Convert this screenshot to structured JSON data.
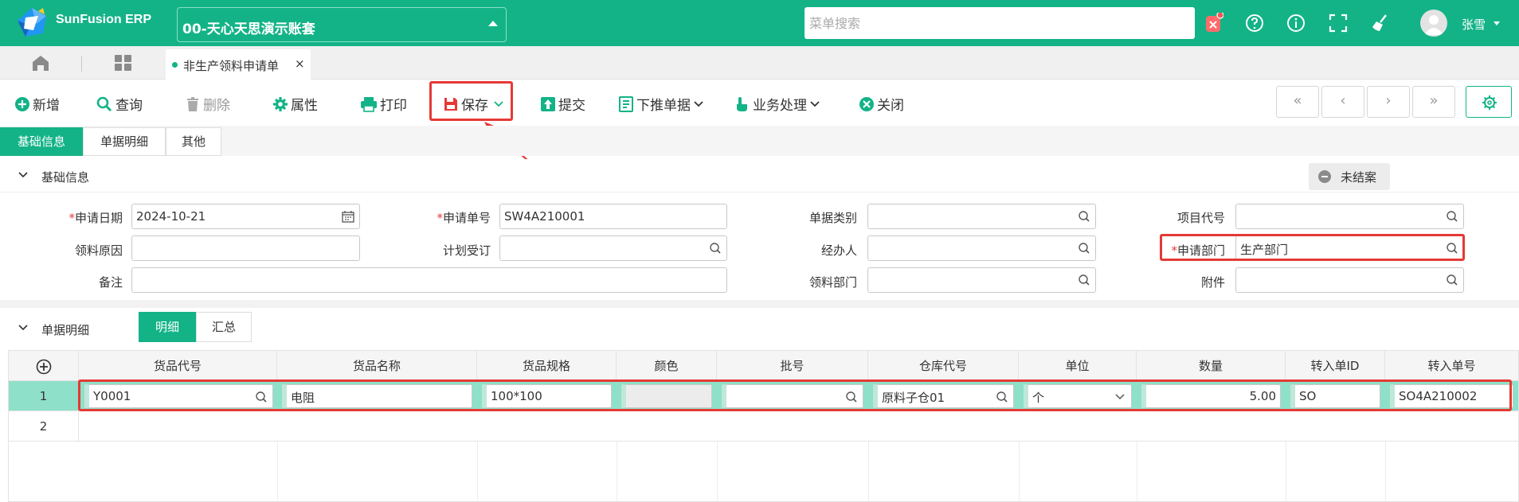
{
  "app": {
    "brand": "SunFusion ERP",
    "account": "00-天心天思演示账套",
    "search_placeholder": "菜单搜索",
    "user": "张雪"
  },
  "colors": {
    "primary": "#13b387",
    "highlight": "#e53935"
  },
  "tabs": {
    "doc_tab": "非生产领料申请单",
    "close": "×"
  },
  "toolbar": {
    "new": "新增",
    "query": "查询",
    "delete": "删除",
    "props": "属性",
    "print": "打印",
    "save": "保存",
    "submit": "提交",
    "push_down": "下推单据",
    "business": "业务处理",
    "close": "关闭",
    "nav": [
      "«",
      "‹",
      "›",
      "»"
    ]
  },
  "section_tabs": [
    "基础信息",
    "单据明细",
    "其他"
  ],
  "basic": {
    "title": "基础信息",
    "status": "未结案",
    "fields": {
      "apply_date_label": "申请日期",
      "apply_date": "2024-10-21",
      "apply_no_label": "申请单号",
      "apply_no": "SW4A210001",
      "doc_type_label": "单据类别",
      "project_label": "项目代号",
      "reason_label": "领料原因",
      "plan_label": "计划受订",
      "handler_label": "经办人",
      "dept_label": "申请部门",
      "dept": "生产部门",
      "remark_label": "备注",
      "pick_dept_label": "领料部门",
      "attach_label": "附件"
    }
  },
  "detail": {
    "title": "单据明细",
    "tabs": [
      "明细",
      "汇总"
    ],
    "columns": [
      "货品代号",
      "货品名称",
      "货品规格",
      "颜色",
      "批号",
      "仓库代号",
      "单位",
      "数量",
      "转入单ID",
      "转入单号"
    ],
    "rows": [
      {
        "no": "1",
        "code": "Y0001",
        "name": "电阻",
        "spec": "100*100",
        "color": "",
        "batch": "",
        "warehouse": "原料子仓01",
        "unit": "个",
        "qty": "5.00",
        "src_id": "SO",
        "src_no": "SO4A210002"
      },
      {
        "no": "2"
      }
    ]
  }
}
